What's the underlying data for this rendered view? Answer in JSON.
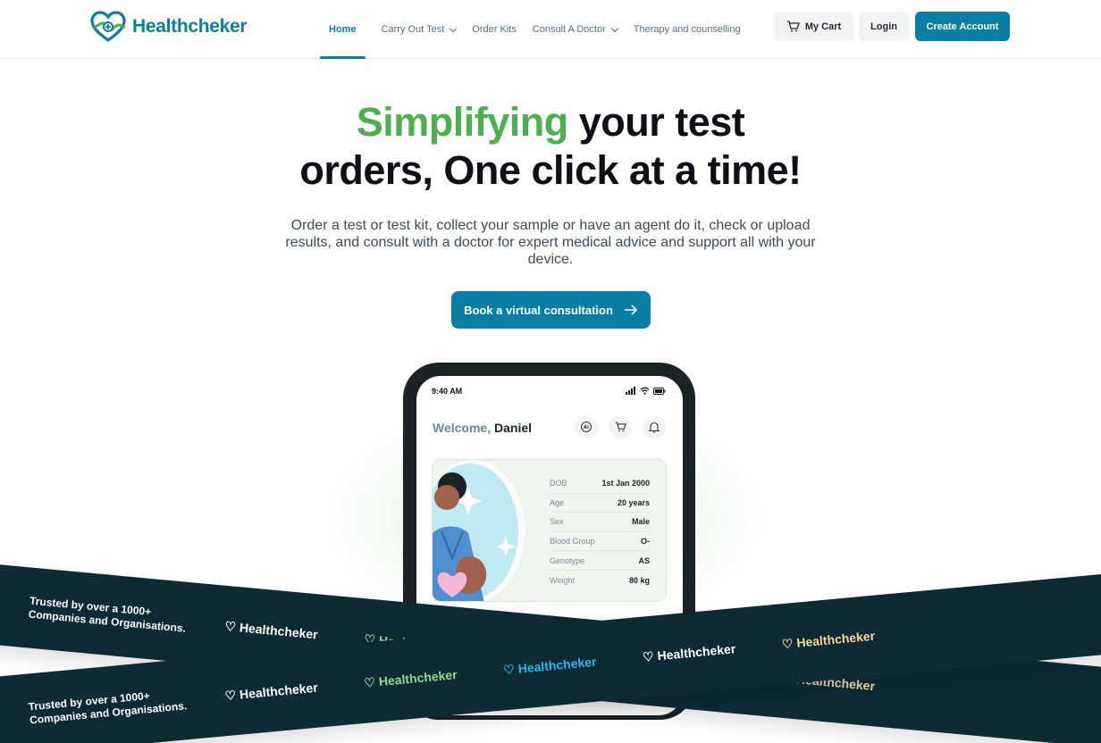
{
  "nav": {
    "brand": "Healthcheker",
    "items": [
      {
        "label": "Home",
        "active": true
      },
      {
        "label": "Carry Out Test",
        "dropdown": true
      },
      {
        "label": "Order Kits"
      },
      {
        "label": "Consult A Doctor",
        "dropdown": true
      },
      {
        "label": "Therapy and counselling"
      }
    ],
    "cart_label": "My Cart",
    "login_label": "Login",
    "create_label": "Create Account"
  },
  "hero": {
    "title_accent": "Simplifying",
    "title_line1_rest": "your test",
    "title_line2": "orders, One click at a time!",
    "subtitle": "Order a test or test kit, collect your sample or have an agent do it, check or upload results, and consult with a doctor for expert medical advice and support all with your device.",
    "cta_label": "Book a virtual consultation"
  },
  "phone": {
    "time": "9:40 AM",
    "welcome_prefix": "Welcome,",
    "user_name": "Daniel",
    "profile": [
      {
        "key": "DOB",
        "value": "1st Jan 2000"
      },
      {
        "key": "Age",
        "value": "20 years"
      },
      {
        "key": "Sex",
        "value": "Male"
      },
      {
        "key": "Blood Group",
        "value": "O-"
      },
      {
        "key": "Genotype",
        "value": "AS"
      },
      {
        "key": "Weight",
        "value": "80 kg"
      }
    ]
  },
  "banner": {
    "trust_line1": "Trusted by over a 1000+",
    "trust_line2": "Companies and Organisations.",
    "brand": "Healthcheker"
  },
  "colors": {
    "primary": "#0a7ea4",
    "accent_green": "#4caf50",
    "banner_bg": "#0e2a33"
  }
}
